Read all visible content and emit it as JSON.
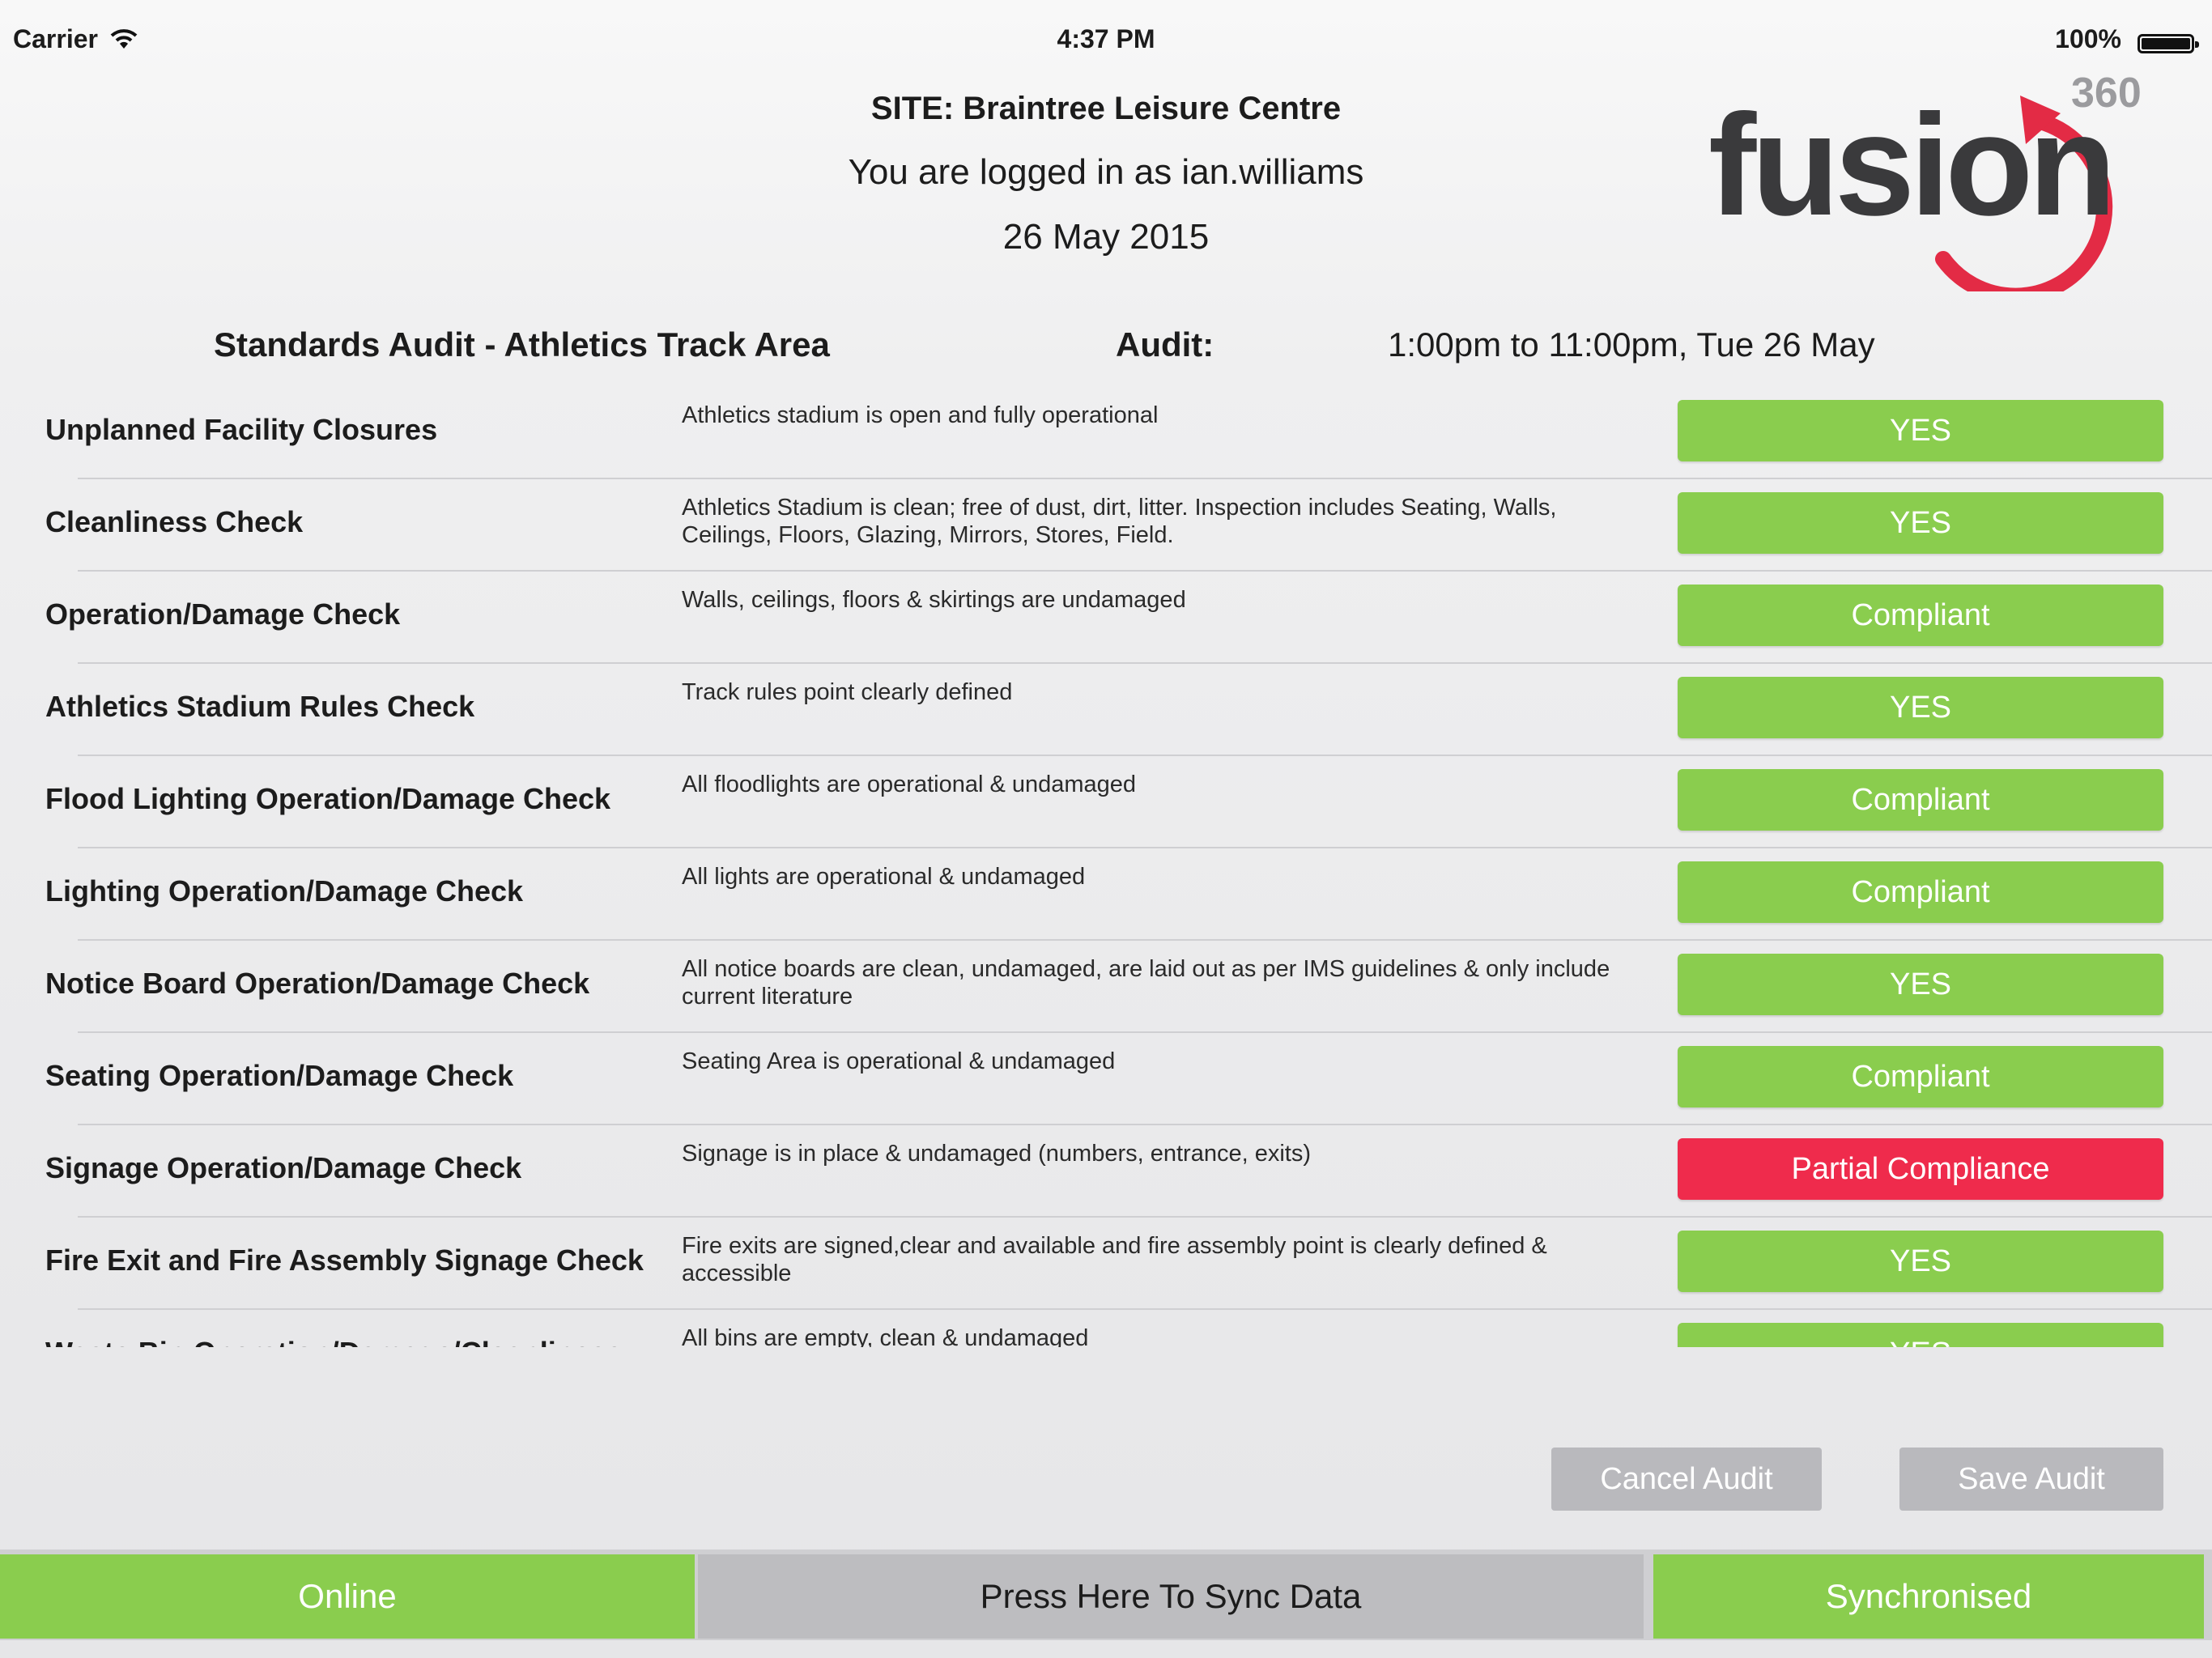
{
  "status_bar": {
    "carrier": "Carrier",
    "time": "4:37 PM",
    "battery": "100%"
  },
  "header": {
    "site": "SITE: Braintree Leisure Centre",
    "login": "You are logged in as ian.williams",
    "date": "26 May 2015"
  },
  "logo": {
    "brand": "fusion",
    "badge": "360",
    "colors": {
      "text": "#3a3a3c",
      "accent": "#e32b45",
      "badge": "#9b9b9e"
    }
  },
  "audit": {
    "title": "Standards Audit - Athletics Track Area",
    "label": "Audit:",
    "time": "1:00pm to 11:00pm, Tue 26 May"
  },
  "items": [
    {
      "name": "Unplanned Facility Closures",
      "desc": "Athletics stadium is open and fully operational",
      "status": "YES",
      "state": "ok"
    },
    {
      "name": "Cleanliness Check",
      "desc": "Athletics Stadium is clean; free of dust, dirt, litter. Inspection includes Seating, Walls, Ceilings, Floors, Glazing, Mirrors, Stores, Field.",
      "status": "YES",
      "state": "ok"
    },
    {
      "name": "Operation/Damage Check",
      "desc": "Walls, ceilings, floors & skirtings are undamaged",
      "status": "Compliant",
      "state": "ok"
    },
    {
      "name": "Athletics Stadium Rules Check",
      "desc": "Track rules point clearly defined",
      "status": "YES",
      "state": "ok"
    },
    {
      "name": "Flood Lighting Operation/Damage Check",
      "desc": "All floodlights are operational & undamaged",
      "status": "Compliant",
      "state": "ok"
    },
    {
      "name": "Lighting Operation/Damage Check",
      "desc": "All lights are operational & undamaged",
      "status": "Compliant",
      "state": "ok"
    },
    {
      "name": "Notice Board Operation/Damage  Check",
      "desc": "All notice boards are clean, undamaged, are laid out as per IMS guidelines & only include current literature",
      "status": "YES",
      "state": "ok"
    },
    {
      "name": "Seating Operation/Damage Check",
      "desc": "Seating Area is operational & undamaged",
      "status": "Compliant",
      "state": "ok"
    },
    {
      "name": "Signage Operation/Damage Check",
      "desc": "Signage is in place & undamaged (numbers, entrance, exits)",
      "status": "Partial Compliance",
      "state": "fail"
    },
    {
      "name": "Fire Exit and Fire Assembly Signage Check",
      "desc": "Fire exits are signed,clear and available and fire assembly point is clearly defined & accessible",
      "status": "YES",
      "state": "ok"
    },
    {
      "name": "Waste Bin Operation/Damage/Cleanliness",
      "desc": "All bins are empty, clean & undamaged",
      "status": "YES",
      "state": "ok"
    }
  ],
  "actions": {
    "cancel": "Cancel Audit",
    "save": "Save Audit"
  },
  "bottom_bar": {
    "online": "Online",
    "sync": "Press Here To Sync Data",
    "synced": "Synchronised"
  },
  "colors": {
    "ok_green": "#8acd4e",
    "fail_red": "#ef2b4c",
    "disabled_grey": "#b9b9bd"
  }
}
